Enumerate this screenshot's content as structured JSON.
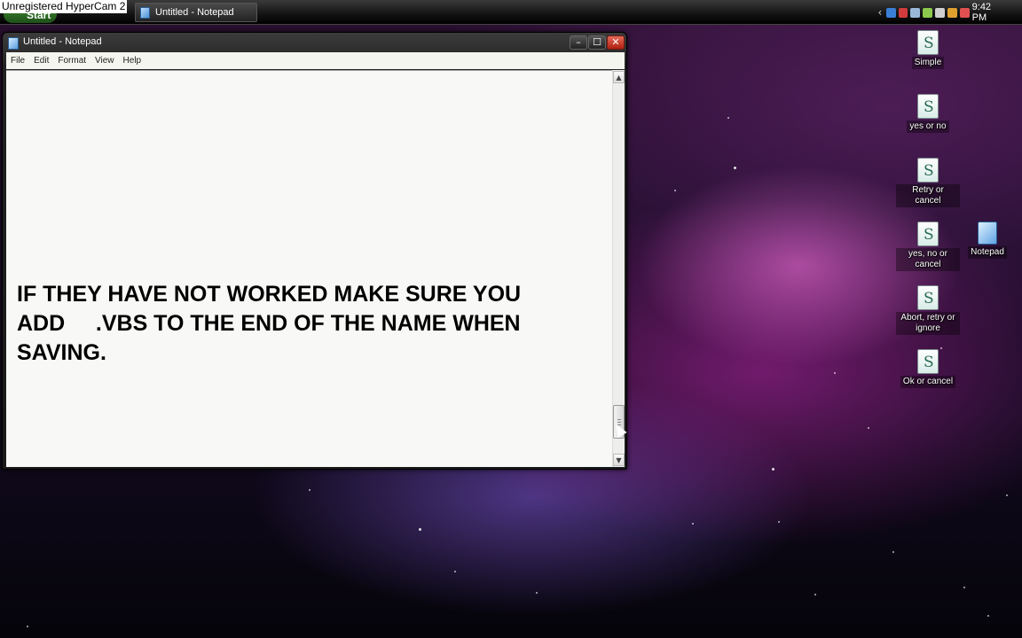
{
  "watermark": "Unregistered HyperCam 2",
  "taskbar": {
    "start_label": "Start",
    "task_button_label": "Untitled - Notepad",
    "clock": "9:42 PM",
    "tray_icons": [
      "network-icon",
      "security-icon",
      "volume-icon",
      "power-icon",
      "connection-icon",
      "update-icon",
      "tool-icon"
    ]
  },
  "window": {
    "title": "Untitled - Notepad",
    "controls": {
      "minimize": "–",
      "maximize": "☐",
      "close": "✕"
    },
    "menu": [
      "File",
      "Edit",
      "Format",
      "View",
      "Help"
    ],
    "editor_text": "IF THEY HAVE NOT WORKED MAKE SURE YOU\nADD     .VBS TO THE END OF THE NAME WHEN\nSAVING.",
    "scrollbar": {
      "up": "▲",
      "down": "▼",
      "position": 0.9
    }
  },
  "desktop_icons": [
    {
      "label": "Simple",
      "type": "script-icon"
    },
    {
      "label": "yes or no",
      "type": "script-icon"
    },
    {
      "label": "Retry or cancel",
      "type": "script-icon"
    },
    {
      "label": "yes, no or cancel",
      "type": "script-icon"
    },
    {
      "label": "Abort, retry or ignore",
      "type": "script-icon"
    },
    {
      "label": "Ok or cancel",
      "type": "script-icon"
    },
    {
      "label": "Notepad",
      "type": "notepad-shortcut-icon"
    }
  ],
  "colors": {
    "taskbar": "#151515",
    "editor_bg": "#f8f8f6",
    "close_button": "#c8321f",
    "desktop_accent": "#c040b0"
  }
}
